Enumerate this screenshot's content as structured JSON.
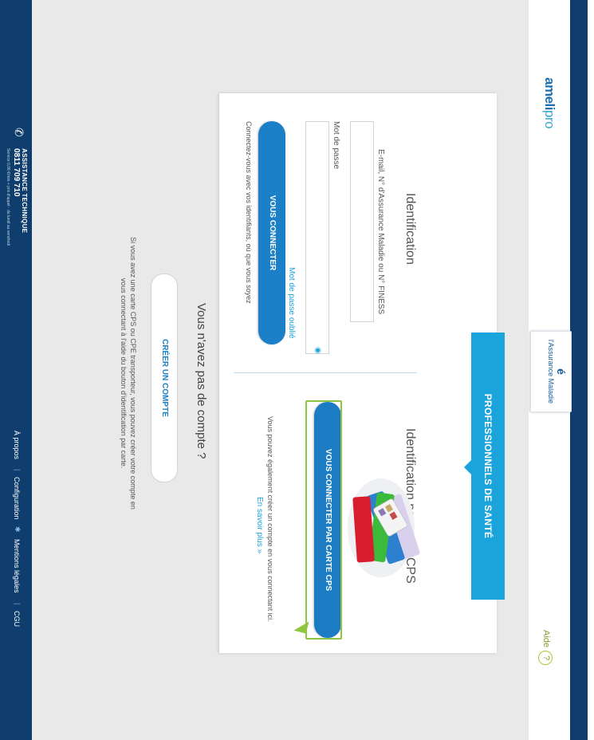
{
  "header": {
    "logo_main": "ameli",
    "logo_sub": "pro",
    "insurance_logo_glyph": "é",
    "insurance_logo_name": "l'Assurance Maladie",
    "help_label": "Aide",
    "help_icon_glyph": "?"
  },
  "login": {
    "banner": "PROFESSIONNELS DE SANTÉ",
    "identification": {
      "title": "Identification",
      "id_label": "E-mail, N° d'Assurance Maladie ou N° FINESS",
      "id_value": "",
      "password_label": "Mot de passe",
      "password_value": "",
      "eye_icon_glyph": "◉",
      "forgot_password_link": "Mot de passe oublié",
      "connect_button": "VOUS CONNECTER",
      "connect_note": "Connectez-vous avec vos identifiants, où que vous soyez"
    },
    "cps": {
      "title": "Identification par carte CPS",
      "connect_button": "VOUS CONNECTER PAR CARTE CPS",
      "note": "Vous pouvez également créer un compte en vous connectant ici.",
      "learn_more_link": "En savoir plus »"
    }
  },
  "no_account": {
    "title": "Vous n'avez pas de compte ?",
    "create_button": "CRÉER UN COMPTE",
    "note": "Si vous avez une carte CPS ou CPE transporteur, vous pouvez créer votre compte en vous connectant à l'aide du bouton d'identification par carte."
  },
  "footer": {
    "phone_icon_glyph": "✆",
    "support_title": "ASSISTANCE TECHNIQUE",
    "support_number": "0811 709 710",
    "support_subtext": "Service 0,06 €/min + prix d'appel · du lundi au vendredi",
    "links": [
      "À propos",
      "Configuration",
      "Mentions légales",
      "CGU"
    ],
    "separator": "|",
    "star_glyph": "✱"
  },
  "colors": {
    "navy": "#0f3e6e",
    "accent_blue": "#1ba3dc",
    "button_blue": "#1b80c8",
    "highlight_green": "#8ec63f"
  }
}
